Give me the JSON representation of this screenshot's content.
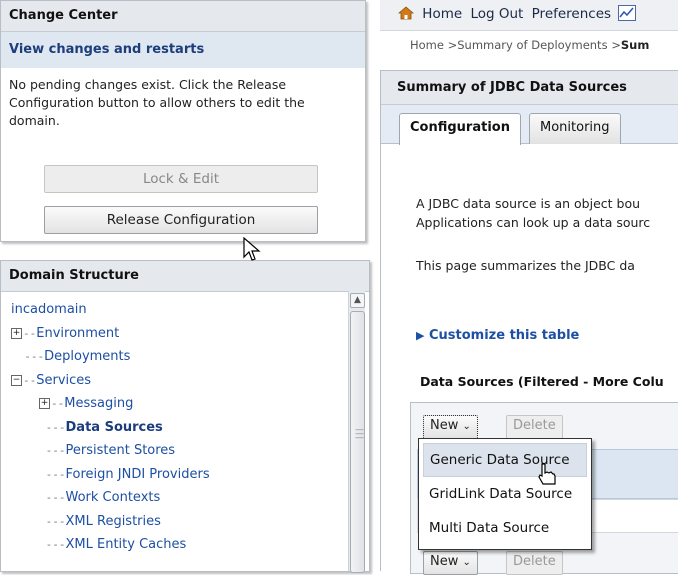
{
  "change_center": {
    "title": "Change Center",
    "subtitle": "View changes and restarts",
    "message": "No pending changes exist. Click the Release Configuration button to allow others to edit the domain.",
    "lock_button": "Lock & Edit",
    "release_button": "Release Configuration"
  },
  "domain_structure": {
    "title": "Domain Structure",
    "root": "incadomain",
    "items": [
      {
        "label": "Environment",
        "expander": "+"
      },
      {
        "label": "Deployments"
      },
      {
        "label": "Services",
        "expander": "−"
      },
      {
        "label": "Messaging",
        "expander": "+"
      },
      {
        "label": "Data Sources"
      },
      {
        "label": "Persistent Stores"
      },
      {
        "label": "Foreign JNDI Providers"
      },
      {
        "label": "Work Contexts"
      },
      {
        "label": "XML Registries"
      },
      {
        "label": "XML Entity Caches"
      }
    ]
  },
  "top_nav": {
    "home": "Home",
    "logout": "Log Out",
    "preferences": "Preferences"
  },
  "breadcrumb": {
    "prefix": "Home >Summary of Deployments >",
    "current": "Sum"
  },
  "summary": {
    "title": "Summary of JDBC Data Sources",
    "tabs": [
      "Configuration",
      "Monitoring"
    ],
    "desc_line1": "A JDBC data source is an object bou",
    "desc_line2": "Applications can look up a data sourc",
    "desc_line3": "This page summarizes the JDBC da",
    "customize": "Customize this table",
    "table_title": "Data Sources (Filtered - More Colu",
    "new_button": "New",
    "delete_button": "Delete"
  },
  "new_menu": {
    "items": [
      "Generic Data Source",
      "GridLink Data Source",
      "Multi Data Source"
    ]
  },
  "colors": {
    "link": "#1d4fa3",
    "header_bg": "#e5e8ed",
    "tab_bg": "#e4ebf4",
    "home_icon": "#d07a1a"
  },
  "icons": [
    "home-icon",
    "chart-icon",
    "expander-icon",
    "scroll-up-icon",
    "disclosure-triangle-icon",
    "chevron-down-icon",
    "arrow-cursor",
    "hand-cursor"
  ]
}
